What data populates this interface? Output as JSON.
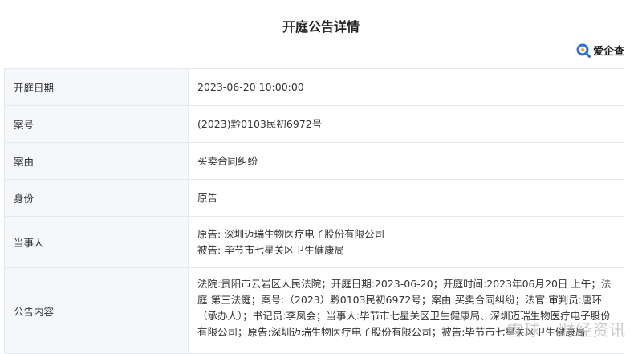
{
  "page": {
    "title": "开庭公告详情"
  },
  "brand": {
    "name": "爱企查",
    "icon": "magnifier-logo-icon",
    "accent": "#2b6de5"
  },
  "details": {
    "rows": [
      {
        "label": "开庭日期",
        "value": "2023-06-20 10:00:00"
      },
      {
        "label": "案号",
        "value": "(2023)黔0103民初6972号"
      },
      {
        "label": "案由",
        "value": "买卖合同纠纷"
      },
      {
        "label": "身份",
        "value": "原告"
      }
    ],
    "party": {
      "label": "当事人",
      "plaintiff": "原告: 深圳迈瑞生物医疗电子股份有限公司",
      "defendant": "被告: 毕节市七星关区卫生健康局"
    },
    "notice": {
      "label": "公告内容",
      "text": "法院:贵阳市云岩区人民法院；开庭日期:2023-06-20；开庭时间:2023年06月20日 上午；法庭:第三法庭；案号:（2023）黔0103民初6972号；案由:买卖合同纠纷；法官:审判员:唐环（承办人）；书记员:李凤会；当事人:毕节市七星关区卫生健康局、深圳迈瑞生物医疗电子股份有限公司；原告:深圳迈瑞生物医疗电子股份有限公司；被告:毕节市七星关区卫生健康局"
    }
  },
  "watermark": "雪球 · 财经资讯"
}
